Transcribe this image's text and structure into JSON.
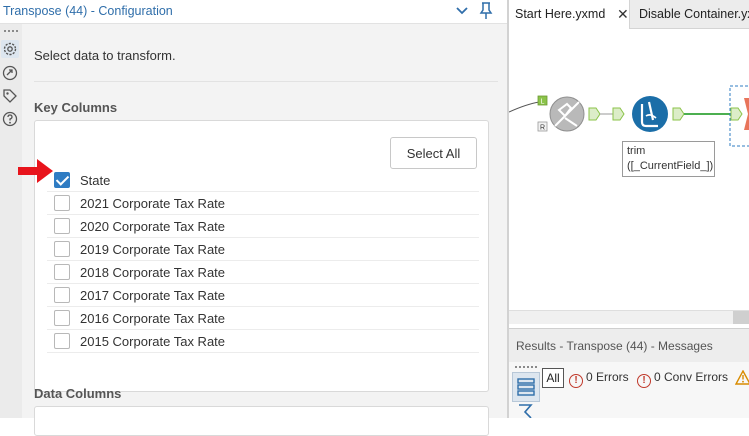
{
  "config": {
    "title": "Transpose (44) - Configuration",
    "icons": [
      "chevron-down-icon",
      "pin-icon",
      "gear-icon",
      "connection-icon",
      "tag-icon",
      "help-icon"
    ],
    "instruction": "Select data to transform.",
    "key_columns": {
      "label": "Key Columns",
      "select_all_label": "Select All",
      "columns": [
        {
          "label": "State",
          "checked": true
        },
        {
          "label": "2021 Corporate Tax Rate",
          "checked": false
        },
        {
          "label": "2020 Corporate Tax Rate",
          "checked": false
        },
        {
          "label": "2019 Corporate Tax Rate",
          "checked": false
        },
        {
          "label": "2018 Corporate Tax Rate",
          "checked": false
        },
        {
          "label": "2017 Corporate Tax Rate",
          "checked": false
        },
        {
          "label": "2016 Corporate Tax Rate",
          "checked": false
        },
        {
          "label": "2015 Corporate Tax Rate",
          "checked": false
        }
      ]
    },
    "data_columns": {
      "label": "Data Columns"
    }
  },
  "workflow": {
    "tabs": [
      {
        "label": "Start Here.yxmd",
        "active": true
      },
      {
        "label": "Disable Container.yxwz",
        "active": false
      }
    ],
    "tab_close": "✕",
    "join_anchors": [
      "L",
      "R"
    ],
    "tool_label_line1": "trim",
    "tool_label_line2": "([_CurrentField_])"
  },
  "results": {
    "title": "Results - Transpose (44) - Messages",
    "all_label": "All",
    "errors": "0 Errors",
    "conv_errors": "0 Conv Errors"
  },
  "colors": {
    "accent": "#2f7cc3",
    "title_blue": "#2f6eaa",
    "arrow_red": "#e8141c",
    "tool_green_connector": "#8bc34a",
    "formula_blue": "#1b6ea8",
    "transpose_orange": "#e8745a"
  }
}
